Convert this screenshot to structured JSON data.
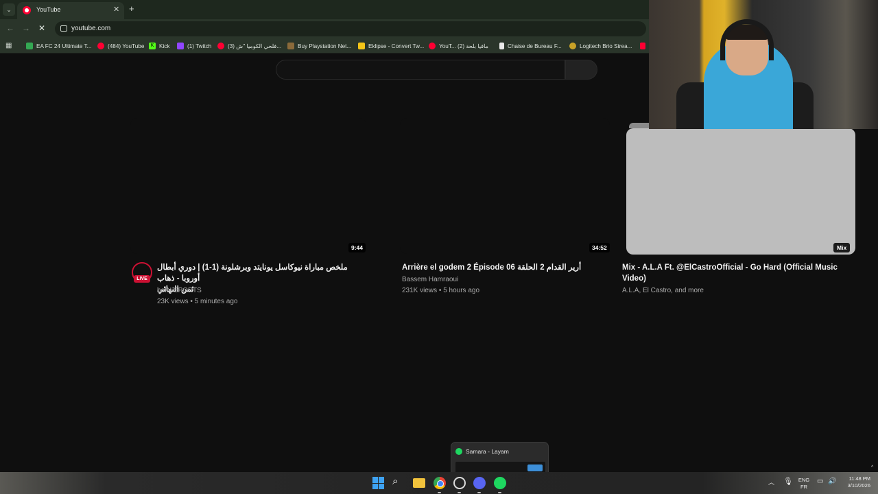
{
  "browser": {
    "tab_title": "YouTube",
    "tab_close": "✕",
    "new_tab": "+",
    "url": "youtube.com",
    "back": "←",
    "forward": "→",
    "reload": "✕",
    "tabsearch": "⌄"
  },
  "bookmarks": [
    {
      "label": "EA FC 24 Ultimate T...",
      "icon": "ea-icon",
      "color": "#34a853"
    },
    {
      "label": "(484) YouTube",
      "icon": "youtube-icon",
      "color": "#ff0033"
    },
    {
      "label": "Kick",
      "icon": "kick-icon",
      "color": "#53fc18"
    },
    {
      "label": "(1) Twitch",
      "icon": "twitch-icon",
      "color": "#9146ff"
    },
    {
      "label": "(3) فلحي الكوميا \"ش...",
      "icon": "youtube-icon",
      "color": "#ff0033"
    },
    {
      "label": "Buy Playstation Net...",
      "icon": "store-icon",
      "color": "#8b6a3a"
    },
    {
      "label": "Eklipse - Convert Tw...",
      "icon": "eklipse-icon",
      "color": "#f5c518"
    },
    {
      "label": "YouT... مافيا بلحة (2)",
      "icon": "youtube-icon",
      "color": "#ff0033"
    },
    {
      "label": "Chaise de Bureau F...",
      "icon": "page-icon",
      "color": "#e8e8e8"
    },
    {
      "label": "Logitech Brio Strea...",
      "icon": "logitech-icon",
      "color": "#c9a227"
    }
  ],
  "videos": [
    {
      "duration": "9:44",
      "title_line1": "ملخص مباراة نيوكاسل يونايتد وبرشلونة (1-1) | دوري أبطال أوروبا - ذهاب",
      "title_line2": "ثمن النهائي",
      "channel": "beIN SPORTS",
      "stats": "23K views • 5 minutes ago",
      "live_label": "LIVE"
    },
    {
      "duration": "34:52",
      "title_line1": "Arrière el godem 2 Épisode 06 أرير القدام 2 الحلقة",
      "title_line2": "",
      "channel": "Bassem Hamraoui",
      "stats": "231K views • 5 hours ago"
    },
    {
      "duration": "Mix",
      "title_line1": "Mix - A.L.A Ft. @ElCastroOfficial - Go Hard (Official Music",
      "title_line2": "Video)",
      "channel": "A.L.A, El Castro, and more",
      "stats": ""
    }
  ],
  "spotify_preview": {
    "title": "Samara - Layam"
  },
  "tray": {
    "lang_top": "ENG",
    "lang_bottom": "FR",
    "time": "11:48 PM",
    "date": "3/10/2026"
  }
}
